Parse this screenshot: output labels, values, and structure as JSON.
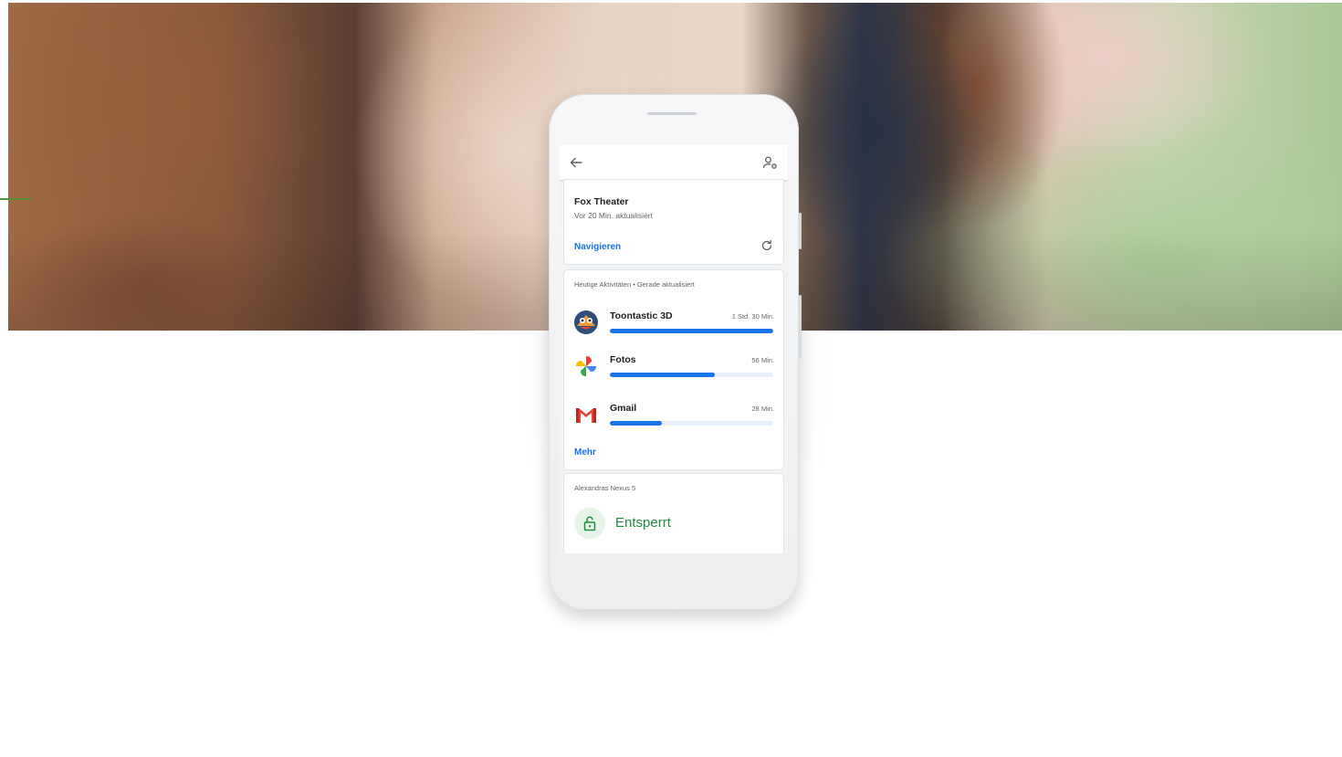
{
  "hero": {
    "description_icon": "photo-banner"
  },
  "screen": {
    "topbar": {
      "back_icon": "arrow-left-icon",
      "manage_icon": "manage-account-icon"
    },
    "location_card": {
      "title": "Fox Theater",
      "subtitle": "Vor 20 Min. aktualisiert",
      "navigate_label": "Navigieren",
      "refresh_icon": "refresh-icon"
    },
    "activity_card": {
      "header": "Heutige Aktivitäten • Gerade aktualisiert",
      "apps": [
        {
          "name": "Toontastic 3D",
          "time": "1 Std. 30 Min.",
          "usage_fraction": 1.0,
          "icon": "toontastic-app-icon"
        },
        {
          "name": "Fotos",
          "time": "56 Min.",
          "usage_fraction": 0.64,
          "icon": "photos-app-icon"
        },
        {
          "name": "Gmail",
          "time": "28 Min.",
          "usage_fraction": 0.32,
          "icon": "gmail-app-icon"
        }
      ],
      "more_label": "Mehr",
      "bar_color": "#1a73e8",
      "track_color": "#e8f0fe"
    },
    "device_card": {
      "device_name": "Alexandras Nexus 5",
      "status": "Entsperrt",
      "status_icon": "lock-open-icon",
      "status_color": "#1e8e3e"
    }
  },
  "colors": {
    "accent": "#1a73e8",
    "success": "#1e8e3e",
    "side_tick": "#5c8f3a"
  }
}
